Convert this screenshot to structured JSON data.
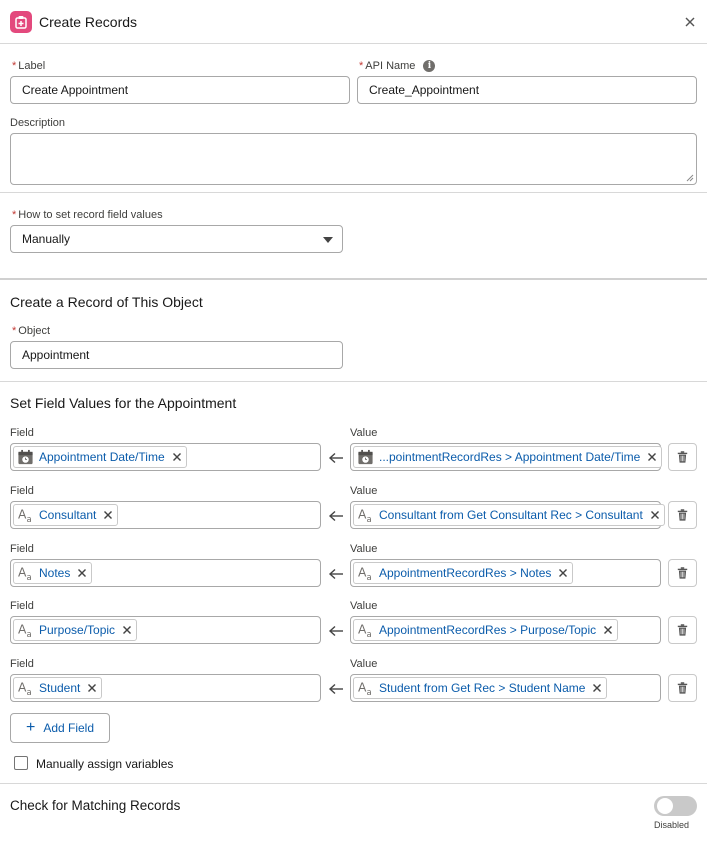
{
  "header": {
    "title": "Create Records"
  },
  "label_field": {
    "label": "Label",
    "value": "Create Appointment"
  },
  "api_name_field": {
    "label": "API Name",
    "value": "Create_Appointment"
  },
  "description_field": {
    "label": "Description",
    "value": ""
  },
  "how_to_set": {
    "label": "How to set record field values",
    "value": "Manually"
  },
  "object_section": {
    "title": "Create a Record of This Object",
    "object_label": "Object",
    "object_value": "Appointment"
  },
  "field_values": {
    "title": "Set Field Values for the Appointment",
    "field_label": "Field",
    "value_label": "Value",
    "rows": [
      {
        "field": "Appointment Date/Time",
        "field_icon": "calendar-icon",
        "value": "...pointmentRecordRes > Appointment Date/Time",
        "value_icon": "calendar-icon"
      },
      {
        "field": "Consultant",
        "field_icon": "text-type-icon",
        "value": "Consultant from Get Consultant Rec > Consultant",
        "value_icon": "text-type-icon"
      },
      {
        "field": "Notes",
        "field_icon": "text-type-icon",
        "value": "AppointmentRecordRes > Notes",
        "value_icon": "text-type-icon"
      },
      {
        "field": "Purpose/Topic",
        "field_icon": "text-type-icon",
        "value": "AppointmentRecordRes > Purpose/Topic",
        "value_icon": "text-type-icon"
      },
      {
        "field": "Student",
        "field_icon": "text-type-icon",
        "value": "Student from Get Rec > Student Name",
        "value_icon": "text-type-icon"
      }
    ],
    "add_field_label": "Add Field"
  },
  "manual_assign": {
    "label": "Manually assign variables",
    "checked": false
  },
  "matching": {
    "title": "Check for Matching Records",
    "toggle_state": "Disabled",
    "enabled": false
  },
  "colors": {
    "accent": "#0b5cab",
    "header_icon": "#e3497d",
    "required": "#c23934"
  }
}
